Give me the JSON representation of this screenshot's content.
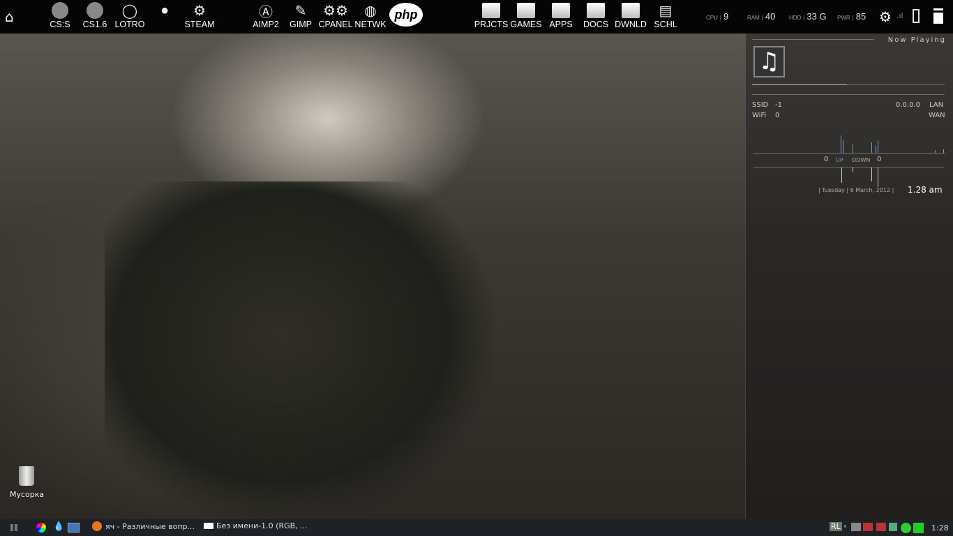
{
  "topbar": {
    "home_icon": "home-icon",
    "launchers": [
      {
        "label": "CS:S",
        "icon": "counter-strike-icon"
      },
      {
        "label": "CS1.6",
        "icon": "counter-strike-icon"
      },
      {
        "label": "LOTRO",
        "icon": "ring-icon"
      },
      {
        "label": "",
        "icon": "character-head-icon"
      },
      {
        "label": "STEAM",
        "icon": "steam-icon"
      },
      {
        "label": "AIMP2",
        "icon": "aimp-icon"
      },
      {
        "label": "GIMP",
        "icon": "gimp-icon"
      },
      {
        "label": "CPANEL",
        "icon": "gears-icon"
      },
      {
        "label": "NETWK",
        "icon": "globe-icon"
      },
      {
        "label": "php",
        "icon": "php-icon"
      },
      {
        "label": "PRJCTS",
        "icon": "folder-icon"
      },
      {
        "label": "GAMES",
        "icon": "folder-icon"
      },
      {
        "label": "APPS",
        "icon": "folder-icon"
      },
      {
        "label": "DOCS",
        "icon": "folder-icon"
      },
      {
        "label": "DWNLD",
        "icon": "folder-icon"
      },
      {
        "label": "SCHL",
        "icon": "dictionary-icon"
      }
    ],
    "stats": [
      {
        "label": "CPU",
        "value": "9"
      },
      {
        "label": "RAM",
        "value": "40"
      },
      {
        "label": "HDD",
        "value": "33 G"
      },
      {
        "label": "PWR",
        "value": "85"
      }
    ]
  },
  "widget": {
    "now_playing": "Now Playing",
    "ssid_label": "SSID",
    "ssid_value": "-1",
    "wifi_label": "WiFi",
    "wifi_value": "0",
    "lan_ip": "0.0.0.0",
    "lan_label": "LAN",
    "wan_label": "WAN",
    "up_value": "0",
    "up_label": "UP",
    "down_label": "DOWN",
    "down_value": "0",
    "date": "| Tuesday | 6 March, 2012 |",
    "time": "1.28 am"
  },
  "desktop": {
    "trash_label": "Мусорка"
  },
  "taskbar": {
    "tasks": [
      "яч - Различные вопр...",
      "Без имени-1.0 (RGB, ..."
    ],
    "lang": "RL",
    "clock": "1:28"
  }
}
